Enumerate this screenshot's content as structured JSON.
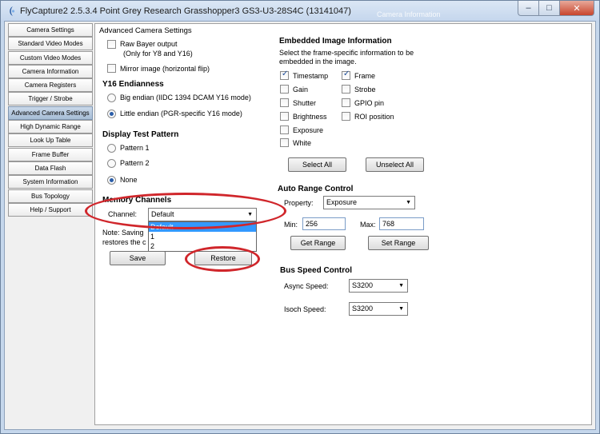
{
  "window": {
    "title": "FlyCapture2 2.5.3.4  Point Grey Research Grasshopper3 GS3-U3-28S4C (13141047)",
    "ghost_title": "Camera Information",
    "min_glyph": "–",
    "max_glyph": "□",
    "close_glyph": "✕"
  },
  "nav": {
    "items": [
      "Camera Settings",
      "Standard Video Modes",
      "Custom Video Modes",
      "Camera Information",
      "Camera Registers",
      "Trigger / Strobe",
      "Advanced Camera Settings",
      "High Dynamic Range",
      "Look Up Table",
      "Frame Buffer",
      "Data Flash",
      "System Information",
      "Bus Topology",
      "Help / Support"
    ],
    "active_index": 6
  },
  "advanced": {
    "group_title": "Advanced Camera Settings",
    "raw_bayer_label": "Raw Bayer output",
    "raw_bayer_sub": "(Only for Y8 and Y16)",
    "mirror_label": "Mirror image (horizontal flip)",
    "y16_heading": "Y16 Endianness",
    "big_endian_label": "Big endian (IIDC 1394 DCAM Y16 mode)",
    "little_endian_label": "Little endian (PGR-specific Y16 mode)",
    "test_pattern_heading": "Display Test Pattern",
    "pattern1_label": "Pattern 1",
    "pattern2_label": "Pattern 2",
    "none_label": "None",
    "memory_heading": "Memory Channels",
    "channel_label": "Channel:",
    "channel_value": "Default",
    "channel_options": [
      "Default",
      "1",
      "2"
    ],
    "note_line1": "Note: Saving",
    "note_line2": "restores the c",
    "save_label": "Save",
    "restore_label": "Restore"
  },
  "embedded": {
    "heading": "Embedded Image Information",
    "desc_line1": "Select the frame-specific information to be",
    "desc_line2": "embedded in the image.",
    "timestamp": "Timestamp",
    "gain": "Gain",
    "shutter": "Shutter",
    "brightness": "Brightness",
    "exposure": "Exposure",
    "white": "White",
    "frame": "Frame",
    "strobe": "Strobe",
    "gpio": "GPIO pin",
    "roi": "ROI position",
    "select_all": "Select All",
    "unselect_all": "Unselect All"
  },
  "auto_range": {
    "heading": "Auto Range Control",
    "property_label": "Property:",
    "property_value": "Exposure",
    "min_label": "Min:",
    "min_value": "256",
    "max_label": "Max:",
    "max_value": "768",
    "get_range": "Get Range",
    "set_range": "Set Range"
  },
  "bus_speed": {
    "heading": "Bus Speed Control",
    "async_label": "Async Speed:",
    "async_value": "S3200",
    "isoch_label": "Isoch Speed:",
    "isoch_value": "S3200"
  },
  "colors": {
    "annotation": "#d0262b",
    "selection": "#3399ff"
  }
}
